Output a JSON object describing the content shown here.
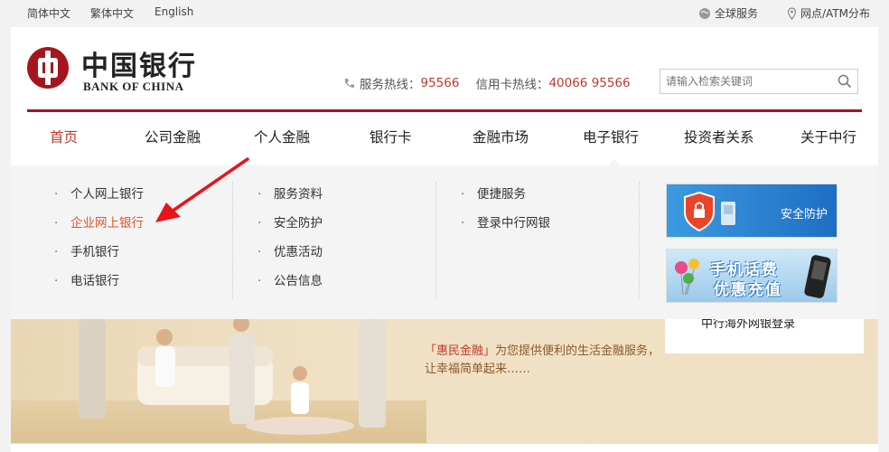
{
  "topbar": {
    "lang_simplified": "简体中文",
    "lang_traditional": "繁体中文",
    "lang_english": "English",
    "global_service": "全球服务",
    "branch_atm": "网点/ATM分布"
  },
  "header": {
    "logo_cn": "中国银行",
    "logo_en": "BANK OF CHINA",
    "service_hotline_label": "服务热线：",
    "service_hotline": "95566",
    "card_hotline_label": "信用卡热线：",
    "card_hotline": "40066 95566",
    "search_placeholder": "请输入检索关键词",
    "brand_color": "#a7151c"
  },
  "nav": {
    "items": [
      {
        "label": "首页",
        "active": true
      },
      {
        "label": "公司金融"
      },
      {
        "label": "个人金融"
      },
      {
        "label": "银行卡"
      },
      {
        "label": "金融市场"
      },
      {
        "label": "电子银行"
      },
      {
        "label": "投资者关系"
      },
      {
        "label": "关于中行"
      }
    ]
  },
  "dropdown": {
    "col1": [
      "个人网上银行",
      "企业网上银行",
      "手机银行",
      "电话银行"
    ],
    "col2": [
      "服务资料",
      "安全防护",
      "优惠活动",
      "公告信息"
    ],
    "col3": [
      "便捷服务",
      "登录中行网银"
    ],
    "banner_security": "安全防护",
    "banner_phone_line1": "手机话费",
    "banner_phone_line2": "优惠充值"
  },
  "hero": {
    "slogan_highlight": "「惠民金融」",
    "slogan_rest": "为您提供便利的生活金融服务，",
    "slogan_line2": "让幸福简单起来……",
    "overseas_login": "中行海外网银登录"
  }
}
